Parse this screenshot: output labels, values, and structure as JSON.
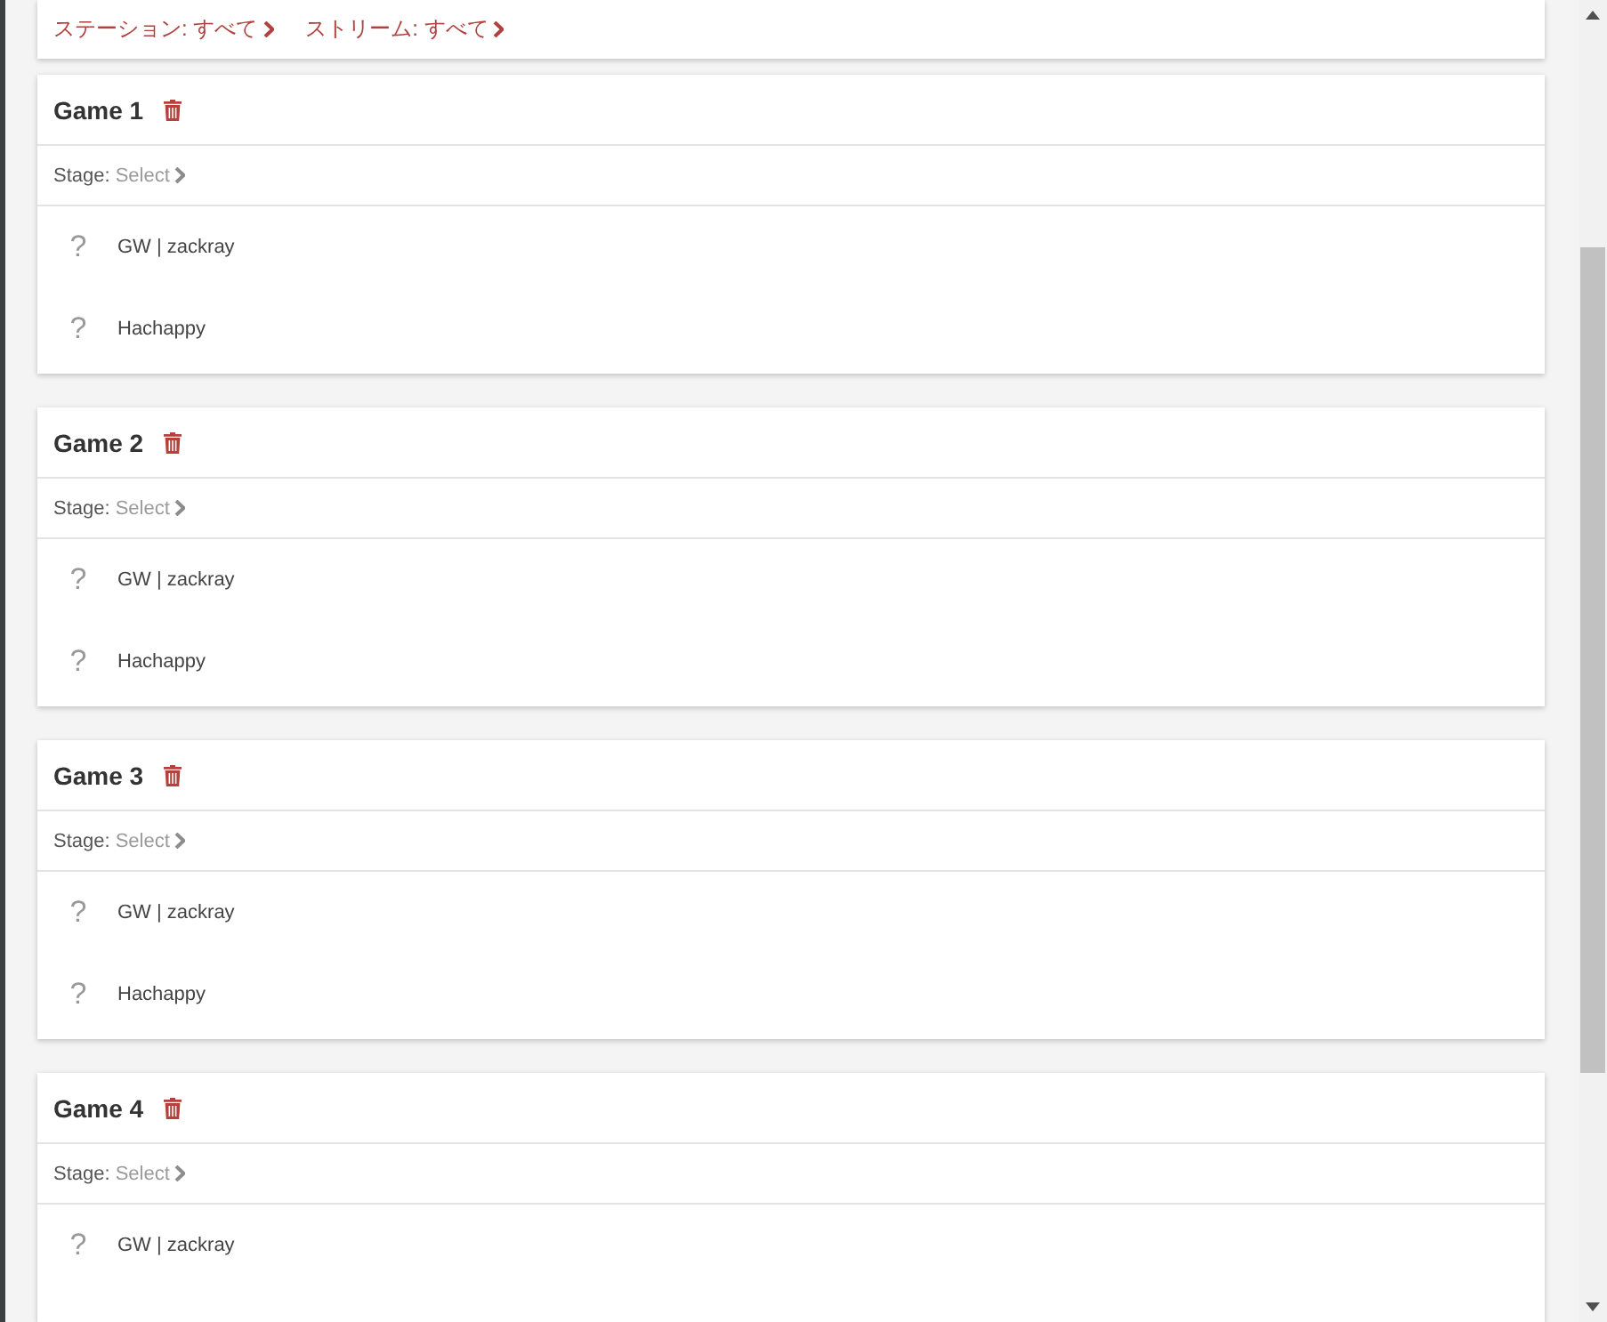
{
  "filters": [
    {
      "label": "ステーション: すべて"
    },
    {
      "label": "ストリーム: すべて"
    }
  ],
  "games": [
    {
      "title": "Game 1",
      "stage": {
        "label": "Stage:",
        "value": "Select"
      },
      "players": [
        {
          "mark": "?",
          "name": "GW | zackray"
        },
        {
          "mark": "?",
          "name": "Hachappy"
        }
      ]
    },
    {
      "title": "Game 2",
      "stage": {
        "label": "Stage:",
        "value": "Select"
      },
      "players": [
        {
          "mark": "?",
          "name": "GW | zackray"
        },
        {
          "mark": "?",
          "name": "Hachappy"
        }
      ]
    },
    {
      "title": "Game 3",
      "stage": {
        "label": "Stage:",
        "value": "Select"
      },
      "players": [
        {
          "mark": "?",
          "name": "GW | zackray"
        },
        {
          "mark": "?",
          "name": "Hachappy"
        }
      ]
    },
    {
      "title": "Game 4",
      "stage": {
        "label": "Stage:",
        "value": "Select"
      },
      "players": [
        {
          "mark": "?",
          "name": "GW | zackray"
        }
      ]
    }
  ]
}
